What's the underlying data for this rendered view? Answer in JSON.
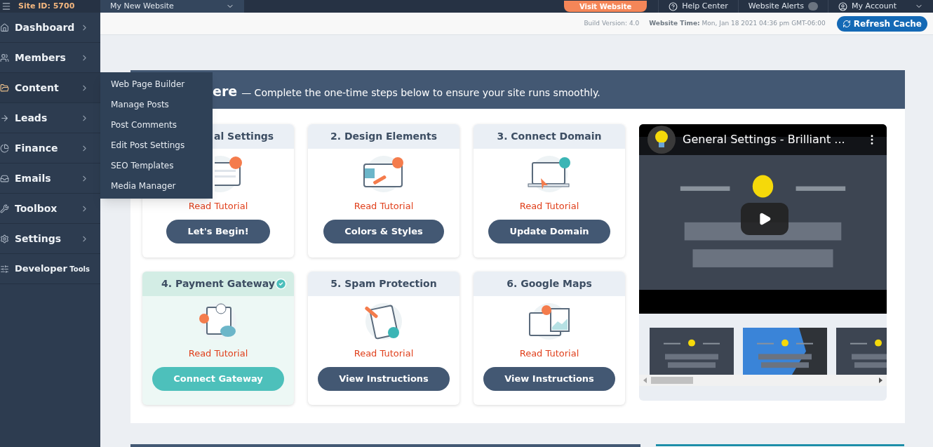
{
  "topbar": {
    "site_id": "Site ID: 5700",
    "website_select": "My New Website",
    "visit_button": "Visit Website",
    "links": [
      {
        "label": "Help Center",
        "kind": "help"
      },
      {
        "label": "Website Alerts",
        "kind": "alerts"
      },
      {
        "label": "My Account",
        "kind": "account"
      }
    ]
  },
  "sidebar": {
    "items": [
      {
        "label": "Dashboard",
        "selected": false
      },
      {
        "label": "Members",
        "selected": false
      },
      {
        "label": "Content",
        "selected": true
      },
      {
        "label": "Leads",
        "selected": false
      },
      {
        "label": "Finance",
        "selected": false
      },
      {
        "label": "Emails",
        "selected": false
      },
      {
        "label": "Toolbox",
        "selected": false
      },
      {
        "label": "Settings",
        "selected": false
      },
      {
        "label": "Developer",
        "suffix": "Tools",
        "selected": false
      }
    ]
  },
  "flyout_menu": {
    "items": [
      "Web Page Builder",
      "Manage Posts",
      "Post Comments",
      "Edit Post Settings",
      "SEO Templates",
      "Media Manager"
    ]
  },
  "info_bar": {
    "build_version": "Build Version: 4.0",
    "time_label": "Website Time:",
    "time_value": "Mon, Jan 18 2021 04:36 pm GMT-06:00",
    "refresh_button": "Refresh Cache"
  },
  "panel": {
    "title": "ere",
    "subtitle": "— Complete the one-time steps below to ensure your site runs smoothly.",
    "cards": [
      {
        "title": "al Settings",
        "completed": false,
        "link": "Read Tutorial",
        "button": "Let's Begin!"
      },
      {
        "title": "2. Design Elements",
        "completed": false,
        "link": "Read Tutorial",
        "button": "Colors & Styles"
      },
      {
        "title": "3. Connect Domain",
        "completed": false,
        "link": "Read Tutorial",
        "button": "Update Domain"
      },
      {
        "title": "4. Payment Gateway",
        "completed": true,
        "link": "Read Tutorial",
        "button": "Connect Gateway"
      },
      {
        "title": "5. Spam Protection",
        "completed": false,
        "link": "Read Tutorial",
        "button": "View Instructions"
      },
      {
        "title": "6. Google Maps",
        "completed": false,
        "link": "Read Tutorial",
        "button": "View Instructions"
      }
    ],
    "video": {
      "title": "General Settings - Brilliant ..."
    }
  }
}
